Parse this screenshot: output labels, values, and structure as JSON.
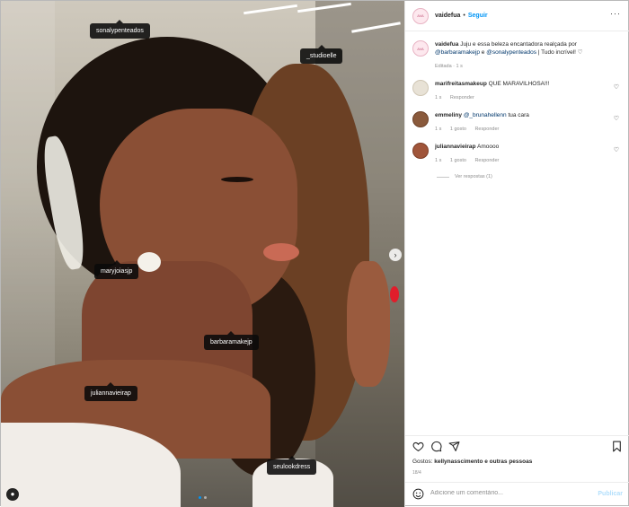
{
  "post": {
    "photo_tags": [
      {
        "label": "sonalypenteados"
      },
      {
        "label": "_studioelle"
      },
      {
        "label": "maryjoiasjp"
      },
      {
        "label": "barbaramakejp"
      },
      {
        "label": "juliannavieirap"
      },
      {
        "label": "seulookdress"
      }
    ],
    "carousel": {
      "current": 1,
      "total": 2
    }
  },
  "header": {
    "username": "vaidefua",
    "separator": "•",
    "follow_label": "Seguir",
    "avatar_text": "AVA"
  },
  "caption": {
    "username": "vaidefua",
    "text_1": "Juju e essa beleza encantadora realçada por",
    "mention_1": "@barbaramakejp",
    "text_2": "e",
    "mention_2": "@sonalypenteados",
    "text_3": "| Tudo incrível! ♡",
    "meta": "Editada · 1 s"
  },
  "comments": [
    {
      "username": "marifreitasmakeup",
      "text": "QUE MARAVILHOSA!!!",
      "time": "1 s",
      "reply": "Responder",
      "likes": ""
    },
    {
      "username": "emmeliny",
      "mention": "@_brunahellenn",
      "text": "tua cara",
      "time": "1 s",
      "likes": "1 gosto",
      "reply": "Responder"
    },
    {
      "username": "juliannavieirap",
      "text": "Amoooo",
      "time": "1 s",
      "likes": "1 gosto",
      "reply": "Responder"
    }
  ],
  "view_replies": "Ver respostas (1)",
  "likes_text_prefix": "Gostos:",
  "likes_text_user": "kellynasscimento",
  "likes_text_suffix": "e outras pessoas",
  "date": "18/4",
  "composer": {
    "placeholder": "Adicione um comentário...",
    "publish_label": "Publicar"
  },
  "colors": {
    "accent": "#0095f6",
    "publish_disabled": "#b2dffc",
    "mention": "#00376b"
  }
}
